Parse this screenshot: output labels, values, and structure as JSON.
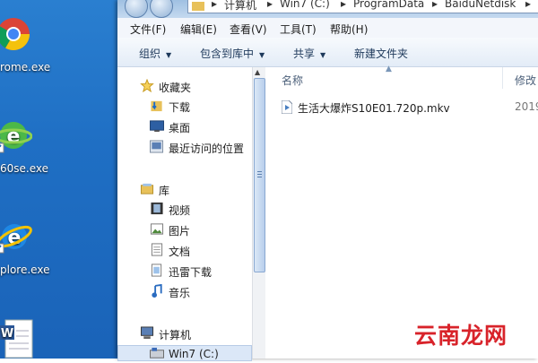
{
  "desktop": {
    "icons": [
      {
        "label": "rome.exe",
        "icon": "chrome-icon"
      },
      {
        "label": "60se.exe",
        "icon": "360se-browser-icon"
      },
      {
        "label": "plore.exe",
        "icon": "internet-explorer-icon"
      },
      {
        "label": "",
        "icon": "word-document-icon"
      }
    ]
  },
  "window": {
    "address": {
      "segments": [
        "计算机",
        "Win7 (C:)",
        "ProgramData",
        "BaiduNetdisk"
      ]
    },
    "menu": [
      "文件(F)",
      "编辑(E)",
      "查看(V)",
      "工具(T)",
      "帮助(H)"
    ],
    "toolbar": {
      "organize": "组织",
      "include_library": "包含到库中",
      "share": "共享",
      "new_folder": "新建文件夹"
    },
    "nav": {
      "favorites": "收藏夹",
      "downloads": "下载",
      "desktop": "桌面",
      "recent": "最近访问的位置",
      "libraries": "库",
      "videos": "视频",
      "pictures": "图片",
      "documents": "文档",
      "xunlei": "迅雷下载",
      "music": "音乐",
      "computer": "计算机",
      "win7": "Win7 (C:)"
    },
    "columns": {
      "name": "名称",
      "modified": "修改"
    },
    "files": [
      {
        "name": "生活大爆炸S10E01.720p.mkv",
        "modified": "2019"
      }
    ]
  },
  "watermark": "云南龙网",
  "colors": {
    "accent": "#1f6fc4",
    "watermark": "#d8232a"
  }
}
